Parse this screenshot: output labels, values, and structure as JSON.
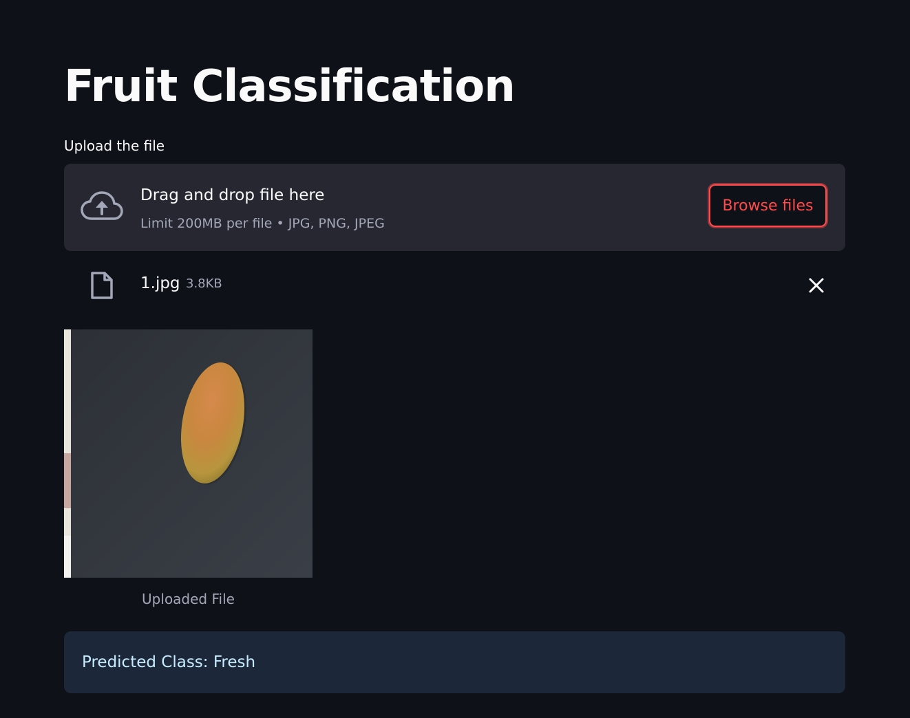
{
  "header": {
    "title": "Fruit Classification"
  },
  "uploader": {
    "label": "Upload the file",
    "drop_text": "Drag and drop file here",
    "limit_text": "Limit 200MB per file • JPG, PNG, JPEG",
    "browse_label": "Browse files",
    "upload_icon": "cloud-upload-icon"
  },
  "uploaded_file": {
    "name": "1.jpg",
    "size": "3.8KB",
    "file_icon": "file-icon",
    "remove_icon": "close-icon"
  },
  "image": {
    "caption": "Uploaded File"
  },
  "result": {
    "text": "Predicted Class: Fresh"
  },
  "colors": {
    "background": "#0e1117",
    "dropzone": "#262730",
    "accent": "#ff4b4b",
    "info_background": "#1c2839",
    "info_text": "#c7ebff"
  }
}
